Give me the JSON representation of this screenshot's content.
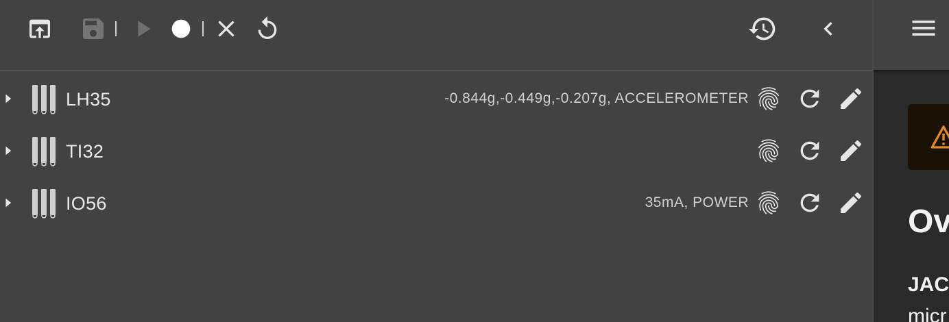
{
  "toolbar": {
    "buttons": [
      {
        "name": "open-icon"
      },
      {
        "name": "save-icon",
        "disabled": true
      },
      {
        "name": "play-icon",
        "disabled": true
      },
      {
        "name": "record-icon"
      },
      {
        "name": "close-icon"
      },
      {
        "name": "reset-icon"
      },
      {
        "name": "history-icon"
      },
      {
        "name": "chevron-left-icon"
      }
    ]
  },
  "devices": [
    {
      "name": "LH35",
      "reading": "-0.844g,-0.449g,-0.207g, ACCELEROMETER"
    },
    {
      "name": "TI32",
      "reading": ""
    },
    {
      "name": "IO56",
      "reading": "35mA, POWER"
    }
  ],
  "right_panel": {
    "heading": "Ov",
    "bold_text": "JAC",
    "body_text": "micr"
  },
  "colors": {
    "background": "#424242",
    "warning": "#e08a2c"
  }
}
